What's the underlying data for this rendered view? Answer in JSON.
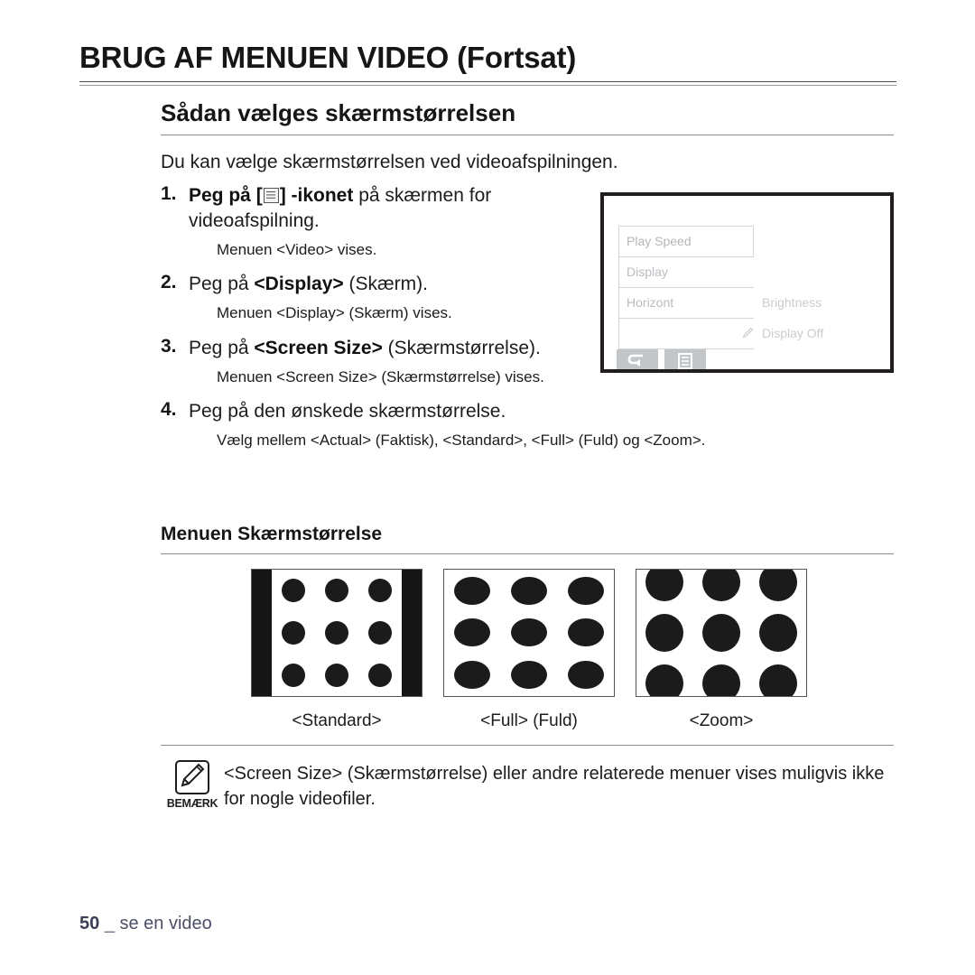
{
  "header": {
    "title": "BRUG AF MENUEN VIDEO (Fortsat)",
    "subtitle": "Sådan vælges skærmstørrelsen",
    "intro": "Du kan vælge skærmstørrelsen ved videoafspilningen."
  },
  "steps": [
    {
      "num": "1.",
      "pre": "Peg på [",
      "icon": "menu-list-icon",
      "post_bold": "] -ikonet",
      "rest": " på skærmen for videoafspilning.",
      "note": "Menuen <Video> vises."
    },
    {
      "num": "2.",
      "pre": "Peg på ",
      "bold": "<Display>",
      "rest": " (Skærm).",
      "note": "Menuen <Display> (Skærm) vises."
    },
    {
      "num": "3.",
      "pre": "Peg på ",
      "bold": "<Screen Size>",
      "rest": " (Skærmstørrelse).",
      "note": "Menuen <Screen Size> (Skærmstørrelse) vises."
    },
    {
      "num": "4.",
      "pre": "Peg på den ønskede skærmstørrelse.",
      "note": "Vælg mellem <Actual> (Faktisk), <Standard>, <Full> (Fuld) og <Zoom>."
    }
  ],
  "device": {
    "menu_items": [
      "Play Speed",
      "Display",
      "Horizont"
    ],
    "right_items": [
      "Brightness",
      "Display Off"
    ],
    "buttons": [
      "back-arrow-icon",
      "menu-list-icon"
    ]
  },
  "section": {
    "heading": "Menuen Skærmstørrelse"
  },
  "figures": [
    {
      "caption": "<Standard>",
      "mode": "standard",
      "bars": true,
      "dot_w": 26,
      "dot_h": 26
    },
    {
      "caption": "<Full> (Fuld)",
      "mode": "full",
      "bars": false,
      "dot_w": 38,
      "dot_h": 30
    },
    {
      "caption": "<Zoom>",
      "mode": "zoom",
      "bars": false,
      "dot_w": 40,
      "dot_h": 40
    }
  ],
  "note": {
    "icon": "note-pencil-icon",
    "label": "BEMÆRK",
    "text": "<Screen Size> (Skærmstørrelse) eller andre relaterede menuer vises muligvis ikke for nogle videofiler."
  },
  "footer": {
    "page": "50",
    "separator": "_",
    "text": "se en video"
  },
  "colors": {
    "text": "#1c1c1c",
    "rule": "#8d8d8d",
    "dot": "#1b1b1b",
    "footer": "#4d4f66",
    "device_border": "#201d1c",
    "device_menu_text": "#b9bcc0"
  }
}
